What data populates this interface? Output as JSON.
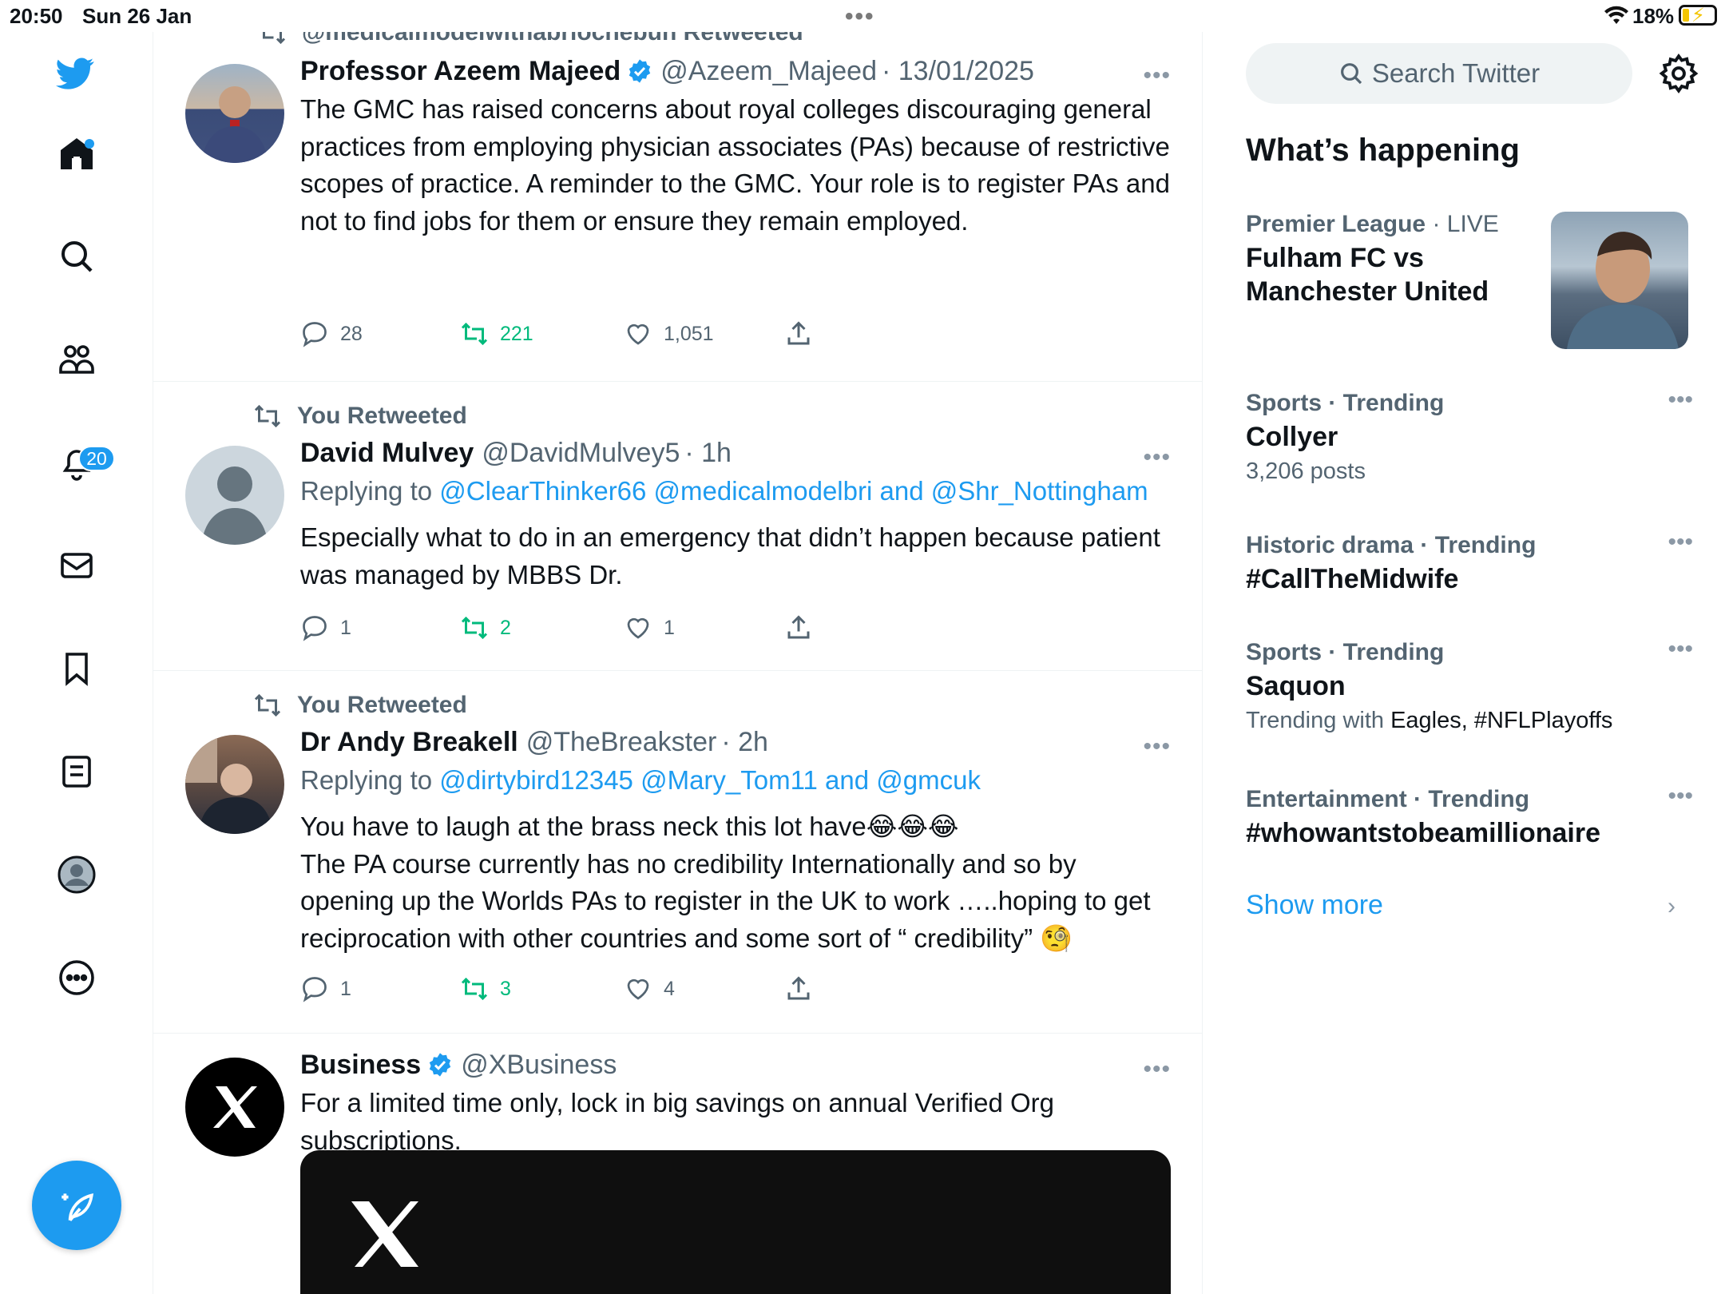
{
  "status_bar": {
    "time": "20:50",
    "date": "Sun 26 Jan",
    "battery": "18%"
  },
  "sidebar": {
    "notifications_badge": "20",
    "items": [
      "twitter-logo",
      "home",
      "explore",
      "communities",
      "notifications",
      "messages",
      "bookmarks",
      "lists",
      "profile",
      "more"
    ]
  },
  "timeline": {
    "tweets": [
      {
        "retweeted_by": "@medicalmodelwithabriochebun Retweeted",
        "name": "Professor Azeem Majeed",
        "handle": "@Azeem_Majeed",
        "time": "· 13/01/2025",
        "verified": true,
        "text": "The GMC has raised concerns about royal colleges discouraging general practices from employing physician associates (PAs) because of restrictive scopes of practice. A reminder to the GMC. Your role is to register PAs and not to find jobs for them or ensure they remain employed.",
        "replies": "28",
        "retweets": "221",
        "likes": "1,051"
      },
      {
        "retweeted_by": "You Retweeted",
        "name": "David Mulvey",
        "handle": "@DavidMulvey5",
        "time": "· 1h",
        "replying_prefix": "Replying to",
        "replying_mentions": "@ClearThinker66 @medicalmodelbri and @Shr_Nottingham",
        "text": "Especially what to do in an emergency that didn’t happen because patient was managed by MBBS Dr.",
        "replies": "1",
        "retweets": "2",
        "likes": "1"
      },
      {
        "retweeted_by": "You Retweeted",
        "name": "Dr Andy Breakell",
        "handle": "@TheBreakster",
        "time": "· 2h",
        "replying_prefix": "Replying to",
        "replying_mentions": "@dirtybird12345 @Mary_Tom11 and @gmcuk",
        "text_line1": "You have to laugh at the brass neck this lot have😂😂😂",
        "text_line2": "The PA course currently has no credibility Internationally and so by opening up the Worlds PAs to register in the UK to work …..hoping to get reciprocation with other countries and some sort of “ credibility” 🧐",
        "replies": "1",
        "retweets": "3",
        "likes": "4"
      },
      {
        "name": "Business",
        "handle": "@XBusiness",
        "verified": true,
        "text": "For a limited time only, lock in big savings on annual Verified Org subscriptions."
      }
    ]
  },
  "right": {
    "search_placeholder": "Search Twitter",
    "heading": "What’s happening",
    "trends": [
      {
        "category": "Premier League",
        "category_extra": "· LIVE",
        "title": "Fulham FC vs Manchester United"
      },
      {
        "category": "Sports · Trending",
        "title": "Collyer",
        "sub": "3,206 posts"
      },
      {
        "category": "Historic drama · Trending",
        "title": "#CallTheMidwife"
      },
      {
        "category": "Sports · Trending",
        "title": "Saquon",
        "sub_prefix": "Trending with",
        "sub_dark": "Eagles, #NFLPlayoffs"
      },
      {
        "category": "Entertainment · Trending",
        "title": "#whowantstobeamillionaire"
      }
    ],
    "show_more": "Show more"
  },
  "colors": {
    "accent": "#1d9bf0",
    "retweet_green": "#00ba7c",
    "secondary_text": "#536471"
  }
}
